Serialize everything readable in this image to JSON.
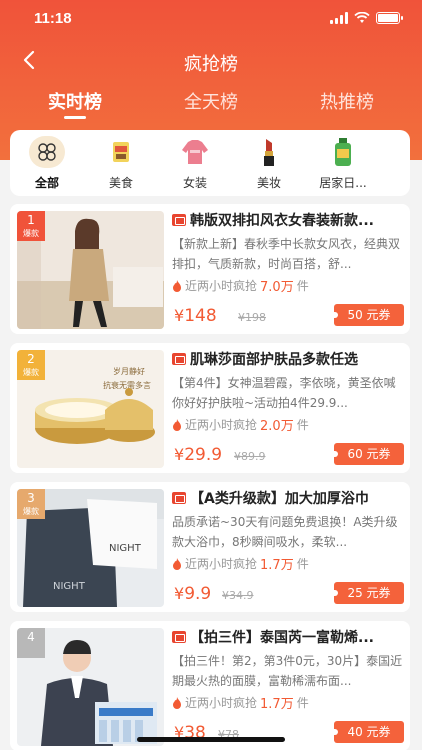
{
  "status_bar": {
    "time": "11:18"
  },
  "nav": {
    "title": "疯抢榜"
  },
  "tabs": [
    {
      "label": "实时榜",
      "active": true
    },
    {
      "label": "全天榜",
      "active": false
    },
    {
      "label": "热推榜",
      "active": false
    }
  ],
  "categories": [
    {
      "label": "全部",
      "icon": "grid-icon",
      "active": true
    },
    {
      "label": "美食",
      "icon": "food-icon",
      "active": false
    },
    {
      "label": "女装",
      "icon": "sweater-icon",
      "active": false
    },
    {
      "label": "美妆",
      "icon": "lipstick-icon",
      "active": false
    },
    {
      "label": "居家日...",
      "icon": "bottle-icon",
      "active": false
    }
  ],
  "products": [
    {
      "rank": "1",
      "rank_sub": "爆款",
      "rank_color": "#f0533a",
      "title": "韩版双排扣风衣女春装新款...",
      "desc": "【新款上新】春秋季中长款女风衣，经典双排扣，气质新款，时尚百搭，舒...",
      "sold_prefix": "近两小时疯抢",
      "sold_count": "7.0万",
      "sold_unit": "件",
      "price_symbol": "¥",
      "price": "148",
      "orig_price": "¥198",
      "coupon": "50 元券"
    },
    {
      "rank": "2",
      "rank_sub": "爆款",
      "rank_color": "#f2b23a",
      "title": "肌琳莎面部护肤品多款任选",
      "desc": "【第4件】女神温碧霞，李依晓，黄圣依喊你好好护肤啦~活动拍4件29.9...",
      "sold_prefix": "近两小时疯抢",
      "sold_count": "2.0万",
      "sold_unit": "件",
      "price_symbol": "¥",
      "price": "29.9",
      "orig_price": "¥89.9",
      "coupon": "60 元券"
    },
    {
      "rank": "3",
      "rank_sub": "爆款",
      "rank_color": "#e6a96d",
      "title": "【A类升级款】加大加厚浴巾",
      "desc": "品质承诺~30天有问题免费退换！A类升级款大浴巾，8秒瞬间吸水，柔软...",
      "sold_prefix": "近两小时疯抢",
      "sold_count": "1.7万",
      "sold_unit": "件",
      "price_symbol": "¥",
      "price": "9.9",
      "orig_price": "¥34.9",
      "coupon": "25 元券"
    },
    {
      "rank": "4",
      "rank_sub": "",
      "rank_color": "#b8b8b8",
      "title": "【拍三件】泰国芮一富勒烯...",
      "desc": "【拍三件！第2，第3件0元，30片】泰国近期最火热的面膜，富勒稀濡布面...",
      "sold_prefix": "近两小时疯抢",
      "sold_count": "1.7万",
      "sold_unit": "件",
      "price_symbol": "¥",
      "price": "38",
      "orig_price": "¥78",
      "coupon": "40 元券"
    }
  ],
  "thumb_text": {
    "p2_slogan1": "岁月静好",
    "p2_slogan2": "抗衰无需多言",
    "p3_brand": "NIGHT"
  }
}
